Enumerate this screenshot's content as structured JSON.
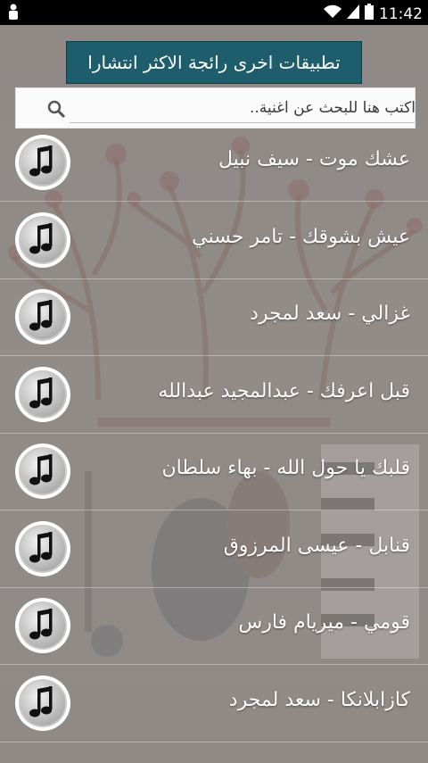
{
  "status_bar": {
    "time": "11:42"
  },
  "banner": {
    "label": "تطبيقات اخرى رائجة الاكثر انتشارا"
  },
  "search": {
    "placeholder": "اكتب هنا للبحث عن اغنية.."
  },
  "songs": [
    {
      "title": "عشك موت - سيف نبيل"
    },
    {
      "title": "عيش بشوقك - تامر حسني"
    },
    {
      "title": "غزالي - سعد لمجرد"
    },
    {
      "title": "قبل اعرفك - عبدالمجيد عبدالله"
    },
    {
      "title": "قلبك يا حول الله - بهاء سلطان"
    },
    {
      "title": "قنابل - عيسى المرزوق"
    },
    {
      "title": "قومي - ميريام فارس"
    },
    {
      "title": "كازابلانكا - سعد لمجرد"
    }
  ],
  "colors": {
    "banner_bg": "#1e5e6c",
    "status_bar_bg": "#000000",
    "title_text": "#ffffff"
  },
  "icons": {
    "song": "music-note-icon",
    "search": "search-icon"
  }
}
